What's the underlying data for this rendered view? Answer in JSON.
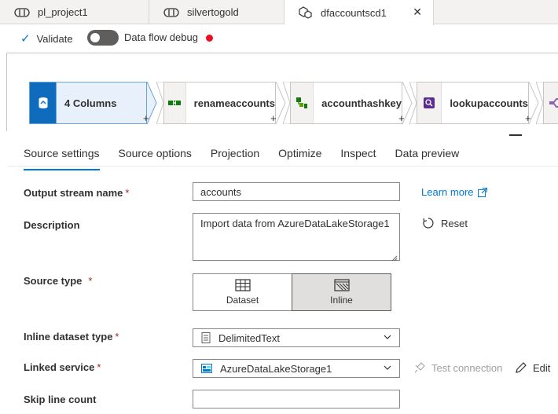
{
  "tabs": [
    {
      "label": "pl_project1",
      "icon": "pipeline-icon"
    },
    {
      "label": "silvertogold",
      "icon": "pipeline-icon"
    },
    {
      "label": "dfaccountscd1",
      "icon": "dataflow-icon",
      "active": true
    }
  ],
  "tab_close_glyph": "✕",
  "toolbar": {
    "validate_label": "Validate",
    "debug_label": "Data flow debug",
    "debug_on": false,
    "status_color": "#e81123"
  },
  "pipeline": {
    "nodes": [
      {
        "label": "4 Columns",
        "icon": "source-icon",
        "selected": true
      },
      {
        "label": "renameaccounts",
        "icon": "select-icon"
      },
      {
        "label": "accounthashkey",
        "icon": "derived-column-icon"
      },
      {
        "label": "lookupaccounts",
        "icon": "lookup-icon"
      }
    ],
    "add_glyph": "+"
  },
  "panel_tabs": [
    "Source settings",
    "Source options",
    "Projection",
    "Optimize",
    "Inspect",
    "Data preview"
  ],
  "active_panel_tab": "Source settings",
  "form": {
    "output_stream": {
      "label": "Output stream name",
      "required": "*",
      "value": "accounts"
    },
    "description": {
      "label": "Description",
      "value": "Import data from AzureDataLakeStorage1"
    },
    "source_type": {
      "label": "Source type",
      "required": "*",
      "options": [
        "Dataset",
        "Inline"
      ],
      "selected": "Inline"
    },
    "inline_dataset_type": {
      "label": "Inline dataset type",
      "required": "*",
      "value": "DelimitedText"
    },
    "linked_service": {
      "label": "Linked service",
      "required": "*",
      "value": "AzureDataLakeStorage1"
    },
    "skip_line_count": {
      "label": "Skip line count",
      "value": ""
    }
  },
  "links": {
    "learn_more": "Learn more",
    "reset": "Reset",
    "test_connection": "Test connection",
    "edit": "Edit"
  },
  "colors": {
    "accent": "#0078d4",
    "selected_node": "#0f6cbd"
  }
}
